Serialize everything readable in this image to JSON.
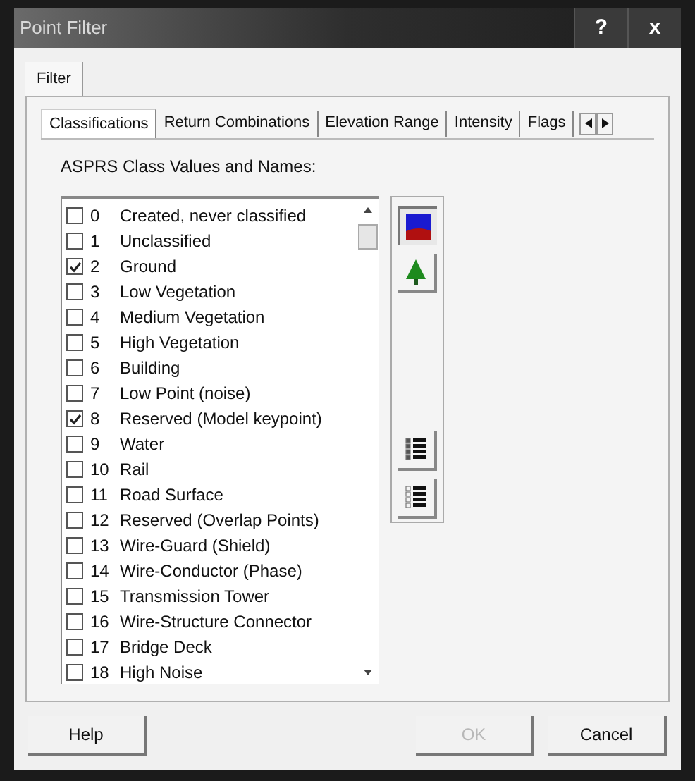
{
  "window": {
    "title": "Point Filter",
    "title_buttons": [
      "?",
      "x"
    ]
  },
  "outer_tabs": [
    {
      "label": "Filter",
      "selected": true
    }
  ],
  "tabs": [
    {
      "label": "Classifications",
      "selected": true
    },
    {
      "label": "Return Combinations",
      "selected": false
    },
    {
      "label": "Elevation Range",
      "selected": false
    },
    {
      "label": "Intensity",
      "selected": false
    },
    {
      "label": "Flags",
      "selected": false
    }
  ],
  "list_label": "ASPRS Class Values and Names:",
  "classes": [
    {
      "value": "0",
      "name": "Created, never classified",
      "checked": false
    },
    {
      "value": "1",
      "name": "Unclassified",
      "checked": false
    },
    {
      "value": "2",
      "name": "Ground",
      "checked": true
    },
    {
      "value": "3",
      "name": "Low Vegetation",
      "checked": false
    },
    {
      "value": "4",
      "name": "Medium Vegetation",
      "checked": false
    },
    {
      "value": "5",
      "name": "High Vegetation",
      "checked": false
    },
    {
      "value": "6",
      "name": "Building",
      "checked": false
    },
    {
      "value": "7",
      "name": "Low Point (noise)",
      "checked": false
    },
    {
      "value": "8",
      "name": "Reserved (Model keypoint)",
      "checked": true
    },
    {
      "value": "9",
      "name": "Water",
      "checked": false
    },
    {
      "value": "10",
      "name": "Rail",
      "checked": false
    },
    {
      "value": "11",
      "name": "Road Surface",
      "checked": false
    },
    {
      "value": "12",
      "name": "Reserved (Overlap Points)",
      "checked": false
    },
    {
      "value": "13",
      "name": "Wire-Guard (Shield)",
      "checked": false
    },
    {
      "value": "14",
      "name": "Wire-Conductor (Phase)",
      "checked": false
    },
    {
      "value": "15",
      "name": "Transmission Tower",
      "checked": false
    },
    {
      "value": "16",
      "name": "Wire-Structure Connector",
      "checked": false
    },
    {
      "value": "17",
      "name": "Bridge Deck",
      "checked": false
    },
    {
      "value": "18",
      "name": "High Noise",
      "checked": false
    }
  ],
  "tools": [
    {
      "kind": "terrain",
      "selected": true
    },
    {
      "kind": "tree",
      "selected": false
    },
    {
      "kind": "checkall",
      "selected": false
    },
    {
      "kind": "uncheckall",
      "selected": false
    }
  ],
  "buttons": [
    {
      "label": "Help",
      "disabled": false
    },
    {
      "label": "OK",
      "disabled": true
    },
    {
      "label": "Cancel",
      "disabled": false
    }
  ]
}
